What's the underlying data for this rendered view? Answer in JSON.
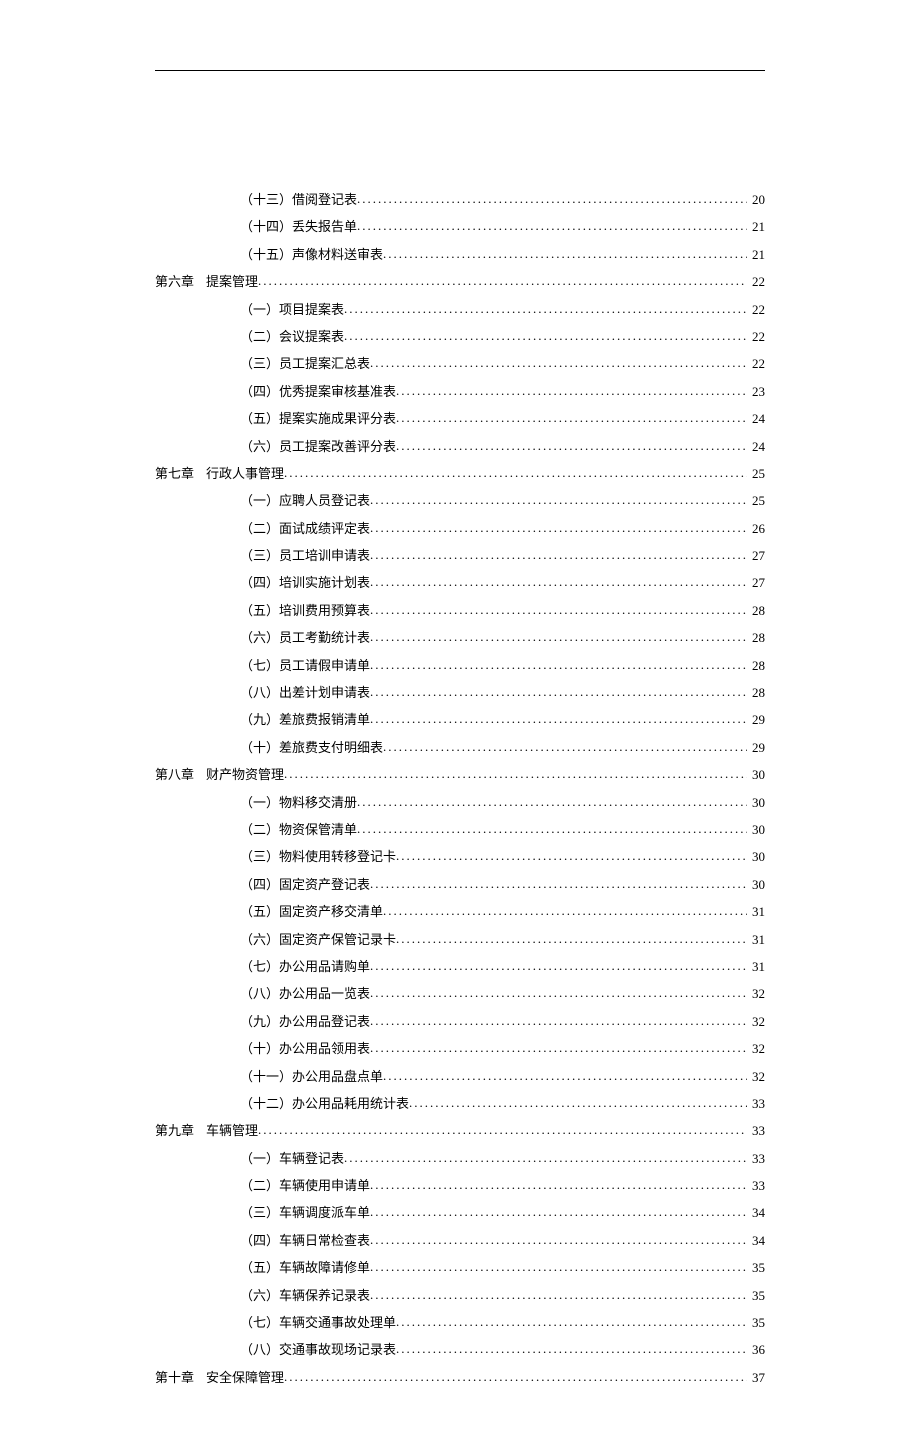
{
  "toc": [
    {
      "type": "sub",
      "label": "（十三）借阅登记表",
      "page": "20"
    },
    {
      "type": "sub",
      "label": "（十四）丢失报告单",
      "page": "21"
    },
    {
      "type": "sub",
      "label": "（十五）声像材料送审表",
      "page": "21"
    },
    {
      "type": "chapter",
      "chapter": "第六章",
      "title": "提案管理",
      "page": "22"
    },
    {
      "type": "sub",
      "label": "（一）项目提案表",
      "page": "22"
    },
    {
      "type": "sub",
      "label": "（二）会议提案表",
      "page": "22"
    },
    {
      "type": "sub",
      "label": "（三）员工提案汇总表",
      "page": "22"
    },
    {
      "type": "sub",
      "label": "（四）优秀提案审核基准表",
      "page": "23"
    },
    {
      "type": "sub",
      "label": "（五）提案实施成果评分表",
      "page": "24"
    },
    {
      "type": "sub",
      "label": "（六）员工提案改善评分表",
      "page": "24"
    },
    {
      "type": "chapter",
      "chapter": "第七章",
      "title": "行政人事管理",
      "page": "25"
    },
    {
      "type": "sub",
      "label": "（一）应聘人员登记表",
      "page": "25"
    },
    {
      "type": "sub",
      "label": "（二）面试成绩评定表",
      "page": "26"
    },
    {
      "type": "sub",
      "label": "（三）员工培训申请表",
      "page": "27"
    },
    {
      "type": "sub",
      "label": "（四）培训实施计划表",
      "page": "27"
    },
    {
      "type": "sub",
      "label": "（五）培训费用预算表",
      "page": "28"
    },
    {
      "type": "sub",
      "label": "（六）员工考勤统计表",
      "page": "28"
    },
    {
      "type": "sub",
      "label": "（七）员工请假申请单",
      "page": "28"
    },
    {
      "type": "sub",
      "label": "（八）出差计划申请表",
      "page": "28"
    },
    {
      "type": "sub",
      "label": "（九）差旅费报销清单",
      "page": "29"
    },
    {
      "type": "sub",
      "label": "（十）差旅费支付明细表",
      "page": "29"
    },
    {
      "type": "chapter",
      "chapter": "第八章",
      "title": "财产物资管理",
      "page": "30"
    },
    {
      "type": "sub",
      "label": "（一）物料移交清册",
      "page": "30"
    },
    {
      "type": "sub",
      "label": "（二）物资保管清单",
      "page": "30"
    },
    {
      "type": "sub",
      "label": "（三）物料使用转移登记卡",
      "page": "30"
    },
    {
      "type": "sub",
      "label": "（四）固定资产登记表",
      "page": "30"
    },
    {
      "type": "sub",
      "label": "（五）固定资产移交清单",
      "page": "31"
    },
    {
      "type": "sub",
      "label": "（六）固定资产保管记录卡",
      "page": "31"
    },
    {
      "type": "sub",
      "label": "（七）办公用品请购单",
      "page": "31"
    },
    {
      "type": "sub",
      "label": "（八）办公用品一览表",
      "page": "32"
    },
    {
      "type": "sub",
      "label": "（九）办公用品登记表",
      "page": "32"
    },
    {
      "type": "sub",
      "label": "（十）办公用品领用表",
      "page": "32"
    },
    {
      "type": "sub",
      "label": "（十一）办公用品盘点单",
      "page": "32"
    },
    {
      "type": "sub",
      "label": "（十二）办公用品耗用统计表",
      "page": "33"
    },
    {
      "type": "chapter",
      "chapter": "第九章",
      "title": "车辆管理",
      "page": "33"
    },
    {
      "type": "sub",
      "label": "（一）车辆登记表",
      "page": "33"
    },
    {
      "type": "sub",
      "label": "（二）车辆使用申请单",
      "page": "33"
    },
    {
      "type": "sub",
      "label": "（三）车辆调度派车单",
      "page": "34"
    },
    {
      "type": "sub",
      "label": "（四）车辆日常检查表",
      "page": "34"
    },
    {
      "type": "sub",
      "label": "（五）车辆故障请修单",
      "page": "35"
    },
    {
      "type": "sub",
      "label": "（六）车辆保养记录表",
      "page": "35"
    },
    {
      "type": "sub",
      "label": "（七）车辆交通事故处理单",
      "page": "35"
    },
    {
      "type": "sub",
      "label": "（八）交通事故现场记录表",
      "page": "36"
    },
    {
      "type": "chapter",
      "chapter": "第十章",
      "title": "安全保障管理",
      "page": "37"
    }
  ]
}
